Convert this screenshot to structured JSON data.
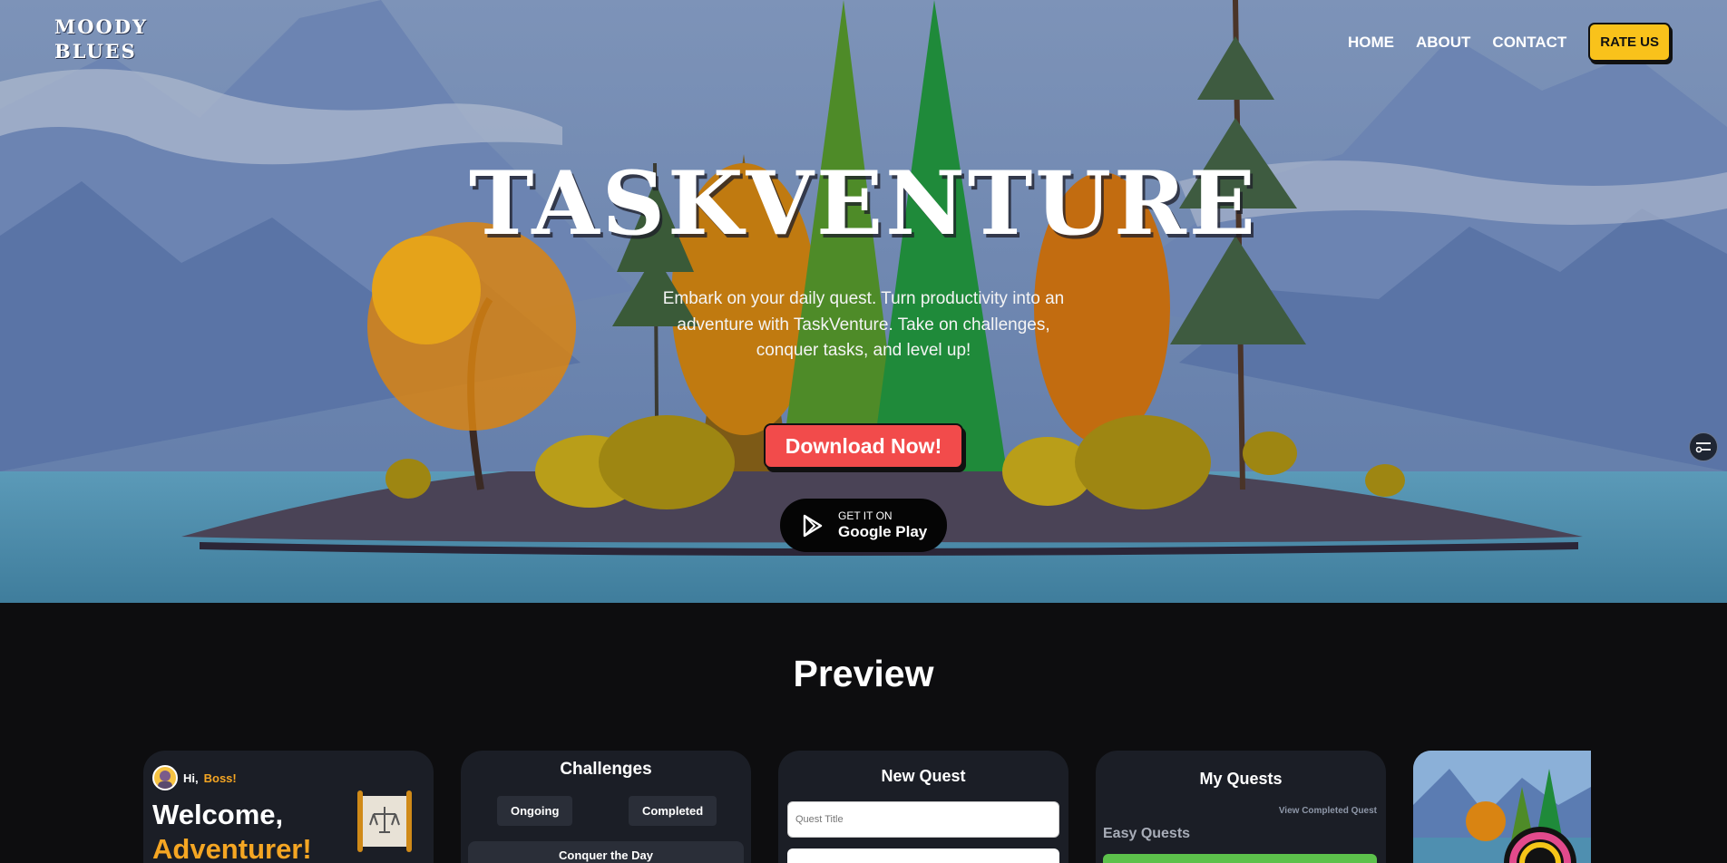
{
  "header": {
    "logo_line1": "MOODY",
    "logo_line2": "BLUES",
    "nav": [
      {
        "label": "HOME"
      },
      {
        "label": "ABOUT"
      },
      {
        "label": "CONTACT"
      }
    ],
    "rate_label": "RATE US"
  },
  "hero": {
    "title": "TASKVENTURE",
    "tagline": "Embark on your daily quest. Turn productivity into an adventure with TaskVenture. Take on challenges, conquer tasks, and level up!",
    "download_label": "Download Now!",
    "google_play_small": "GET IT ON",
    "google_play_large": "Google Play"
  },
  "preview": {
    "title": "Preview",
    "cards": {
      "home": {
        "greeting": "Hi,",
        "name": "Boss!",
        "welcome_line1": "Welcome,",
        "welcome_line2": "Adventurer!"
      },
      "challenges": {
        "title": "Challenges",
        "tab_ongoing": "Ongoing",
        "tab_completed": "Completed",
        "first_item": "Conquer the Day"
      },
      "new_quest": {
        "title": "New Quest",
        "title_placeholder": "Quest Title"
      },
      "my_quests": {
        "title": "My Quests",
        "view_completed": "View Completed Quest",
        "section": "Easy Quests"
      }
    }
  },
  "icons": {
    "google_play": "google-play-icon",
    "side_toggle": "settings-toggle-icon",
    "scroll": "scroll-icon",
    "avatar": "avatar"
  },
  "colors": {
    "accent_yellow": "#f9c21b",
    "download_red": "#f24b4b",
    "quest_orange": "#f5a623",
    "quest_green": "#5cc14b",
    "page_dark": "#0d0d0f"
  }
}
